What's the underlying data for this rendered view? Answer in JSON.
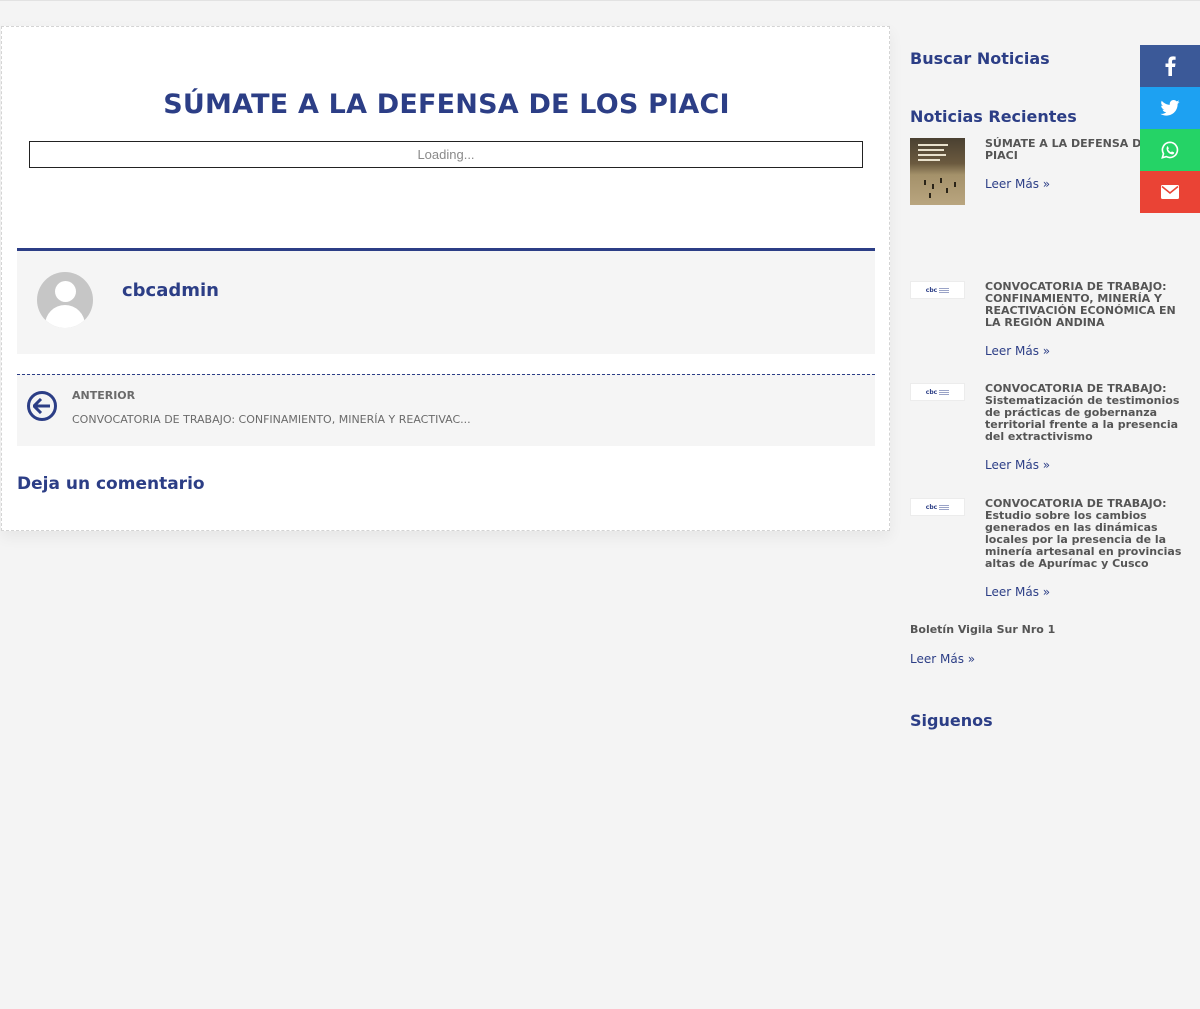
{
  "post": {
    "title": "SÚMATE A LA DEFENSA DE LOS PIACI",
    "embed_loading": "Loading...",
    "author": "cbcadmin",
    "nav": {
      "label": "ANTERIOR",
      "title": "CONVOCATORIA DE TRABAJO: CONFINAMIENTO, MINERÍA Y REACTIVAC..."
    },
    "comment_heading": "Deja un comentario"
  },
  "sidebar": {
    "search_heading": "Buscar Noticias",
    "recent_heading": "Noticias Recientes",
    "recent": [
      {
        "title": "SÚMATE A LA DEFENSA DE LOS PIACI",
        "read_more": "Leer Más »",
        "thumb": "poster-image"
      },
      {
        "title": "CONVOCATORIA DE TRABAJO: CONFINAMIENTO, MINERÍA Y REACTIVACIÓN ECONÓMICA EN LA REGIÓN ANDINA",
        "read_more": "Leer Más »",
        "thumb": "cbc-logo"
      },
      {
        "title": "CONVOCATORIA DE TRABAJO: Sistematización de testimonios de prácticas de gobernanza territorial frente a la presencia del extractivismo",
        "read_more": "Leer Más »",
        "thumb": "cbc-logo"
      },
      {
        "title": "CONVOCATORIA DE TRABAJO: Estudio sobre los cambios generados en las dinámicas locales por la presencia de la minería artesanal en provincias altas de Apurímac y Cusco",
        "read_more": "Leer Más »",
        "thumb": "cbc-logo"
      },
      {
        "title": "Boletín Vigila Sur Nro 1",
        "read_more": "Leer Más »"
      }
    ],
    "follow_heading": "Siguenos"
  },
  "share": [
    {
      "icon": "facebook-icon",
      "color": "#3b5998"
    },
    {
      "icon": "twitter-icon",
      "color": "#1da1f2"
    },
    {
      "icon": "whatsapp-icon",
      "color": "#25d366"
    },
    {
      "icon": "email-icon",
      "color": "#ea4335"
    }
  ],
  "colors": {
    "accent": "#2c3e86",
    "background": "#f4f4f4",
    "card": "#ffffff"
  }
}
